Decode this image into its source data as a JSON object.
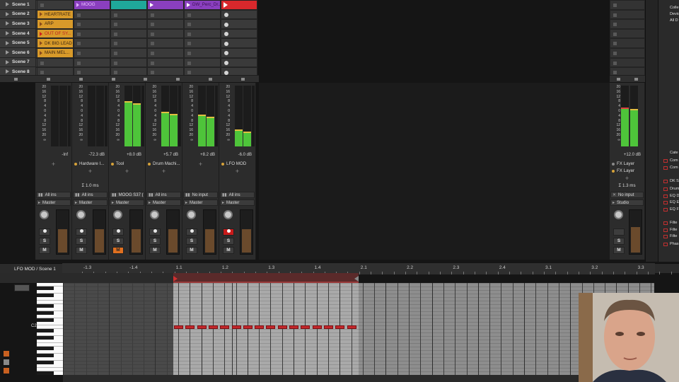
{
  "scenes": [
    "Scene 1",
    "Scene 2",
    "Scene 3",
    "Scene 4",
    "Scene 5",
    "Scene 6",
    "Scene 7",
    "Scene 8"
  ],
  "clips": {
    "HEARTRATE": "HEARTRATE",
    "ARP": "ARP",
    "OUT_OF_SY": "OUT OF SY...",
    "DK_BIG_LEAD": "DK BIG LEAD",
    "MAIN_MEL": "MAIN MEL...",
    "MOOG": "MOOG",
    "DW_PERC": "DW_Perc_Dr..."
  },
  "meter_scale": [
    "20",
    "16",
    "12",
    "8",
    "4",
    "0",
    "4",
    "8",
    "12",
    "16",
    "20",
    "∞"
  ],
  "tracks": [
    {
      "db": "-Inf",
      "device": "",
      "time": "",
      "input": "All ins",
      "output": "Master",
      "level": 0,
      "vol": 0.55,
      "rec": false,
      "mute_on": false
    },
    {
      "db": "-72.3 dB",
      "device": "Hardware I...",
      "time": "Σ 1.0 ms",
      "input": "All ins",
      "output": "Master",
      "level": 0,
      "vol": 0.55,
      "rec": false,
      "mute_on": false
    },
    {
      "db": "+8.0 dB",
      "device": "Tool",
      "time": "",
      "input": "MOOG S37 (*",
      "output": "Master",
      "level": 0.72,
      "vol": 0.55,
      "rec": false,
      "mute_on": true
    },
    {
      "db": "+5.7 dB",
      "device": "Drum Machi...",
      "time": "",
      "input": "All ins",
      "output": "Master",
      "level": 0.55,
      "vol": 0.55,
      "rec": false,
      "mute_on": false
    },
    {
      "db": "+8.2 dB",
      "device": "",
      "time": "",
      "input": "No input",
      "output": "Master",
      "level": 0.5,
      "vol": 0.55,
      "rec": false,
      "mute_on": false
    },
    {
      "db": "-6.0 dB",
      "device": "LFO MOD",
      "time": "",
      "input": "All ins",
      "output": "Master",
      "level": 0.25,
      "vol": 0.55,
      "rec": true,
      "mute_on": false
    }
  ],
  "master": {
    "db": "+12.0 dB",
    "devices": [
      "FX Layer",
      "FX Layer"
    ],
    "time": "Σ 1.3 ms",
    "input": "No input",
    "output": "Studio",
    "level": 0.62
  },
  "buttons": {
    "solo": "S",
    "mute": "M"
  },
  "editor": {
    "title": "LFO MOD / Scene 1",
    "ruler": [
      "-1.3",
      "-1.4",
      "1.1",
      "1.2",
      "1.3",
      "1.4",
      "2.1",
      "2.2",
      "2.3",
      "2.4",
      "3.1",
      "3.2",
      "3.3"
    ],
    "key_label": "C2"
  },
  "browser_items": [
    "Colle",
    "Devic",
    "All D",
    "Cate",
    "Com",
    "Com",
    "DK S",
    "Drum",
    "EQ D",
    "EQ E",
    "EQ F",
    "Filte",
    "Filte",
    "Filte",
    "Phas"
  ],
  "colors": {
    "clip_orange": "#d89a2a",
    "clip_purple": "#8a3fbf",
    "clip_teal": "#1fa89a",
    "clip_red": "#d8282c",
    "meter_green": "#4ec43a",
    "note_red": "#c2262a"
  }
}
